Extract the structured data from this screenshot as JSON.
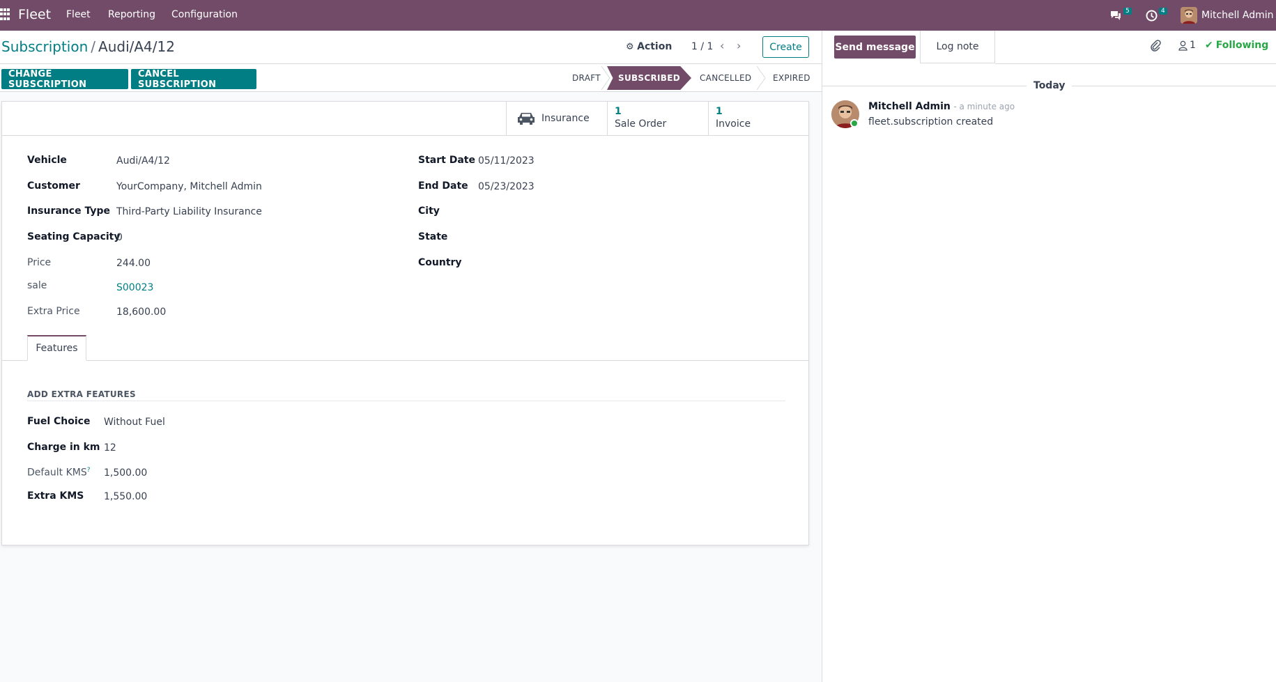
{
  "navbar": {
    "brand": "Fleet",
    "menus": [
      "Fleet",
      "Reporting",
      "Configuration"
    ],
    "messages_count": "5",
    "activities_count": "4",
    "user": "Mitchell Admin"
  },
  "control_panel": {
    "breadcrumb_parent": "Subscription",
    "breadcrumb_separator": "/",
    "breadcrumb_current": "Audi/A4/12",
    "action_label": "Action",
    "pager": "1 / 1",
    "create_label": "Create"
  },
  "statusbar": {
    "change_label": "CHANGE SUBSCRIPTION",
    "cancel_label": "CANCEL SUBSCRIPTION",
    "stages": [
      "DRAFT",
      "SUBSCRIBED",
      "CANCELLED",
      "EXPIRED"
    ],
    "active_stage": "SUBSCRIBED"
  },
  "smart_buttons": {
    "insurance_label": "Insurance",
    "sale_order_count": "1",
    "sale_order_label": "Sale Order",
    "invoice_count": "1",
    "invoice_label": "Invoice"
  },
  "form": {
    "left": [
      {
        "label": "Vehicle",
        "value": "Audi/A4/12"
      },
      {
        "label": "Customer",
        "value": "YourCompany, Mitchell Admin"
      },
      {
        "label": "Insurance Type",
        "value": "Third-Party Liability Insurance"
      },
      {
        "label": "Seating Capacity",
        "value": "0"
      },
      {
        "label": "Price",
        "value": "244.00"
      },
      {
        "label": "sale",
        "value": "S00023"
      },
      {
        "label": "Extra Price",
        "value": "18,600.00"
      }
    ],
    "right": [
      {
        "label": "Start Date",
        "value": "05/11/2023"
      },
      {
        "label": "End Date",
        "value": "05/23/2023"
      },
      {
        "label": "City",
        "value": ""
      },
      {
        "label": "State",
        "value": ""
      },
      {
        "label": "Country",
        "value": ""
      }
    ]
  },
  "tabs": {
    "features_label": "Features",
    "section_title": "ADD EXTRA FEATURES",
    "fields": [
      {
        "label": "Fuel Choice",
        "value": "Without Fuel"
      },
      {
        "label": "Charge in km",
        "value": "12"
      },
      {
        "label": "Default KMS",
        "tooltip": "?",
        "value": "1,500.00"
      },
      {
        "label": "Extra KMS",
        "value": "1,550.00"
      }
    ]
  },
  "chatter": {
    "send_message": "Send message",
    "log_note": "Log note",
    "followers_count": "1",
    "following_label": "Following",
    "day_label": "Today",
    "message_author": "Mitchell Admin",
    "message_time": "- a minute ago",
    "message_body": "fleet.subscription created"
  },
  "colors": {
    "navbar": "#714b67",
    "primary": "#017e84",
    "following": "#28a745"
  }
}
